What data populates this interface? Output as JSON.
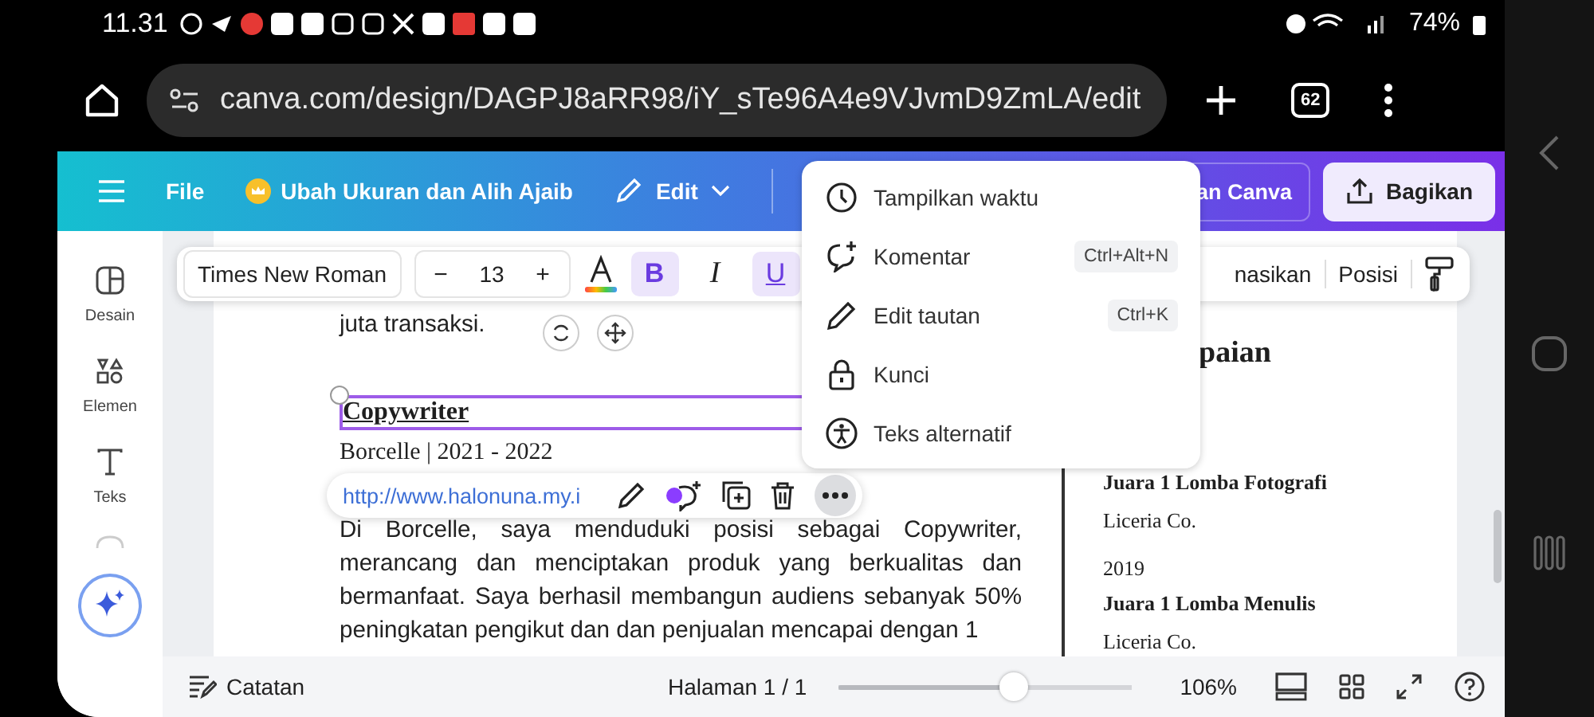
{
  "status_bar": {
    "time": "11.31",
    "battery": "74%"
  },
  "browser": {
    "url": "canva.com/design/DAGPJ8aRR98/iY_sTe96A4e9VJvmD9ZmLA/edit",
    "tab_count": "62"
  },
  "top_bar": {
    "file": "File",
    "resize": "Ubah Ukuran dan Alih Ajaib",
    "edit": "Edit",
    "upgrade": "an Canva",
    "share": "Bagikan"
  },
  "sidebar": {
    "items": [
      {
        "label": "Desain",
        "kind": "design"
      },
      {
        "label": "Elemen",
        "kind": "elements"
      },
      {
        "label": "Teks",
        "kind": "text"
      }
    ]
  },
  "text_toolbar": {
    "font": "Times New Roman",
    "minus": "−",
    "size": "13",
    "plus": "+",
    "format_buttons": [
      {
        "label": "B",
        "kind": "bold",
        "selected": true
      },
      {
        "label": "I",
        "kind": "italic",
        "selected": false
      },
      {
        "label": "U",
        "kind": "underline",
        "selected": true
      }
    ],
    "animate": "nasikan",
    "position": "Posisi"
  },
  "document": {
    "partial_line": "juta transaksi.",
    "job_title": "Copywriter",
    "job_meta": "Borcelle | 2021 - 2022",
    "paragraph": "Di Borcelle, saya menduduki posisi sebagai Copywriter, merancang dan menciptakan produk yang berkualitas dan bermanfaat. Saya berhasil membangun audiens sebanyak 50% peningkatan pengikut dan dan penjualan mencapai dengan 1",
    "side_heading": "paian",
    "awards": [
      {
        "title": "Juara 1 Lomba Fotografi",
        "org": "Liceria Co."
      },
      {
        "year": "2019",
        "title": "Juara 1 Lomba Menulis",
        "org": "Liceria Co."
      }
    ]
  },
  "link_popup": {
    "url": "http://www.halonuna.my.i"
  },
  "context_menu": [
    {
      "label": "Tampilkan waktu",
      "kind": "clock"
    },
    {
      "label": "Komentar",
      "shortcut": "Ctrl+Alt+N",
      "kind": "comment"
    },
    {
      "label": "Edit tautan",
      "shortcut": "Ctrl+K",
      "kind": "pencil"
    },
    {
      "label": "Kunci",
      "kind": "lock"
    },
    {
      "label": "Teks alternatif",
      "kind": "accessibility"
    }
  ],
  "bottom_bar": {
    "notes": "Catatan",
    "page": "Halaman 1 / 1",
    "level": 0.6,
    "zoom": "106%"
  }
}
